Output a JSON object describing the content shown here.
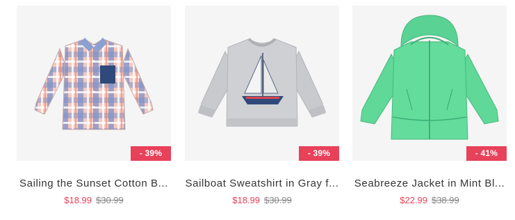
{
  "products": [
    {
      "name": "Sailing the Sunset Cotton B...",
      "sale_price": "$18.99",
      "original_price": "$30.99",
      "discount": "- 39%",
      "image": "plaid-button-shirt"
    },
    {
      "name": "Sailboat Sweatshirt in Gray f...",
      "sale_price": "$18.99",
      "original_price": "$30.99",
      "discount": "- 39%",
      "image": "gray-sailboat-sweatshirt"
    },
    {
      "name": "Seabreeze Jacket in Mint Bl...",
      "sale_price": "$22.99",
      "original_price": "$38.99",
      "discount": "- 41%",
      "image": "mint-hooded-jacket"
    }
  ],
  "colors": {
    "accent": "#e8415a",
    "image_bg": "#f5f5f5",
    "text": "#333333",
    "strike": "#888888"
  }
}
